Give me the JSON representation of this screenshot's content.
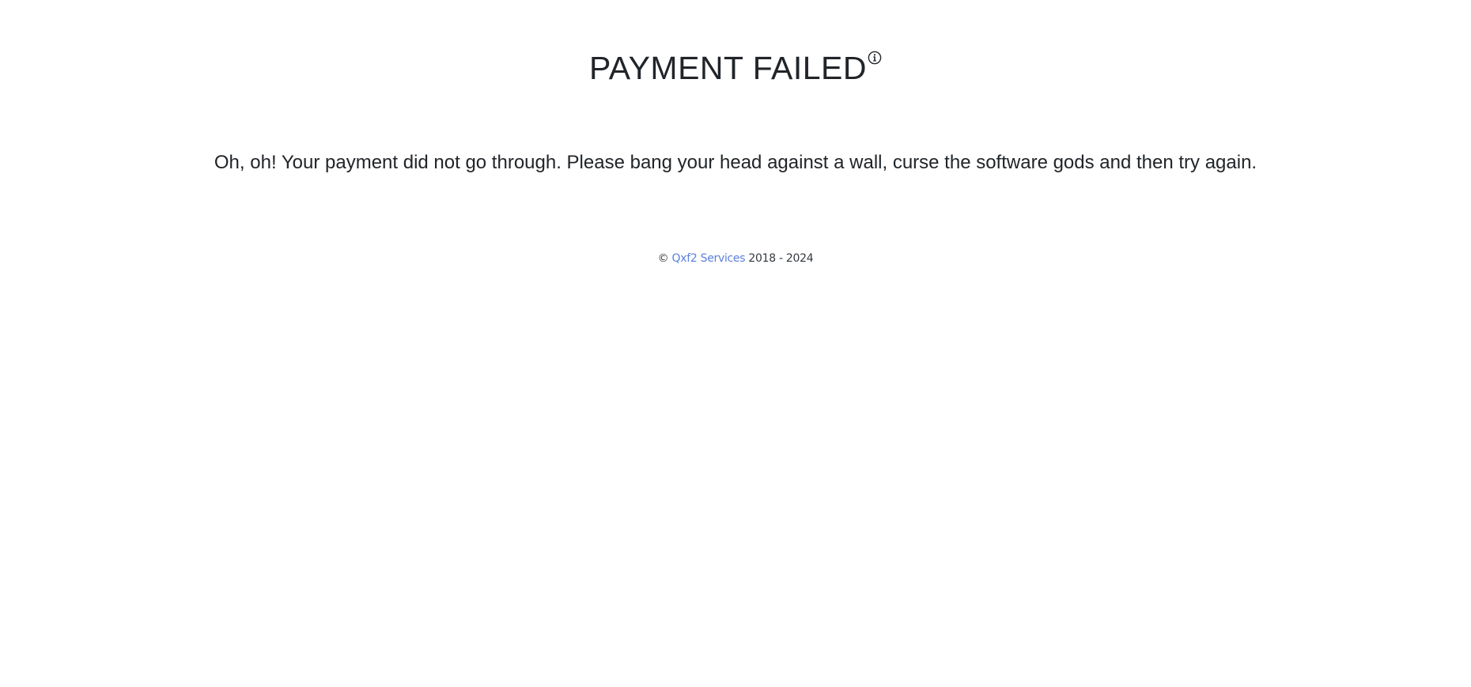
{
  "header": {
    "title": "PAYMENT FAILED",
    "info_icon": "info-circle-icon"
  },
  "main": {
    "message": "Oh, oh! Your payment did not go through. Please bang your head against a wall, curse the software gods and then try again."
  },
  "footer": {
    "copyright_symbol": "©",
    "company_link": "Qxf2 Services",
    "years": "2018 - 2024",
    "link_color": "#5b7fe0"
  }
}
